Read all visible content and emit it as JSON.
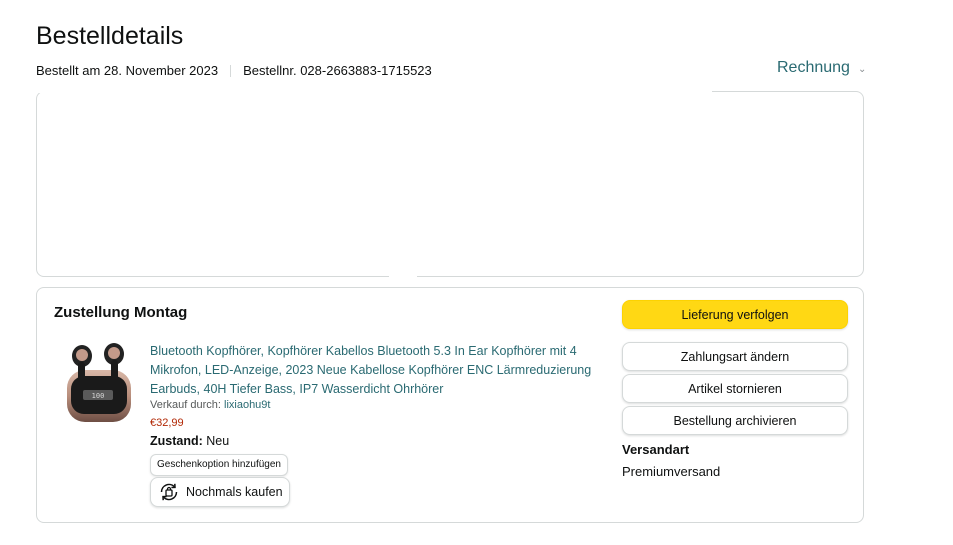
{
  "header": {
    "title": "Bestelldetails",
    "order_date": "Bestellt am 28. November 2023",
    "order_number": "Bestellnr. 028-2663883-1715523",
    "invoice_label": "Rechnung"
  },
  "shipment": {
    "title": "Zustellung Montag",
    "product": {
      "description": "Bluetooth Kopfhörer, Kopfhörer Kabellos Bluetooth 5.3 In Ear Kopfhörer mit 4 Mikrofon, LED-Anzeige, 2023 Neue Kabellose Kopfhörer ENC Lärmreduzierung Earbuds, 40H Tiefer Bass, IP7 Wasserdicht Ohrhörer",
      "sold_by_label": "Verkauf durch:",
      "seller": "lixiaohu9t",
      "price": "€32,99",
      "condition_label": "Zustand:",
      "condition_value": "Neu",
      "gift_option": "Geschenkoption hinzufügen",
      "buy_again": "Nochmals kaufen"
    },
    "actions": {
      "track": "Lieferung verfolgen",
      "change_payment": "Zahlungsart ändern",
      "cancel": "Artikel stornieren",
      "archive": "Bestellung archivieren"
    },
    "shipping_type_label": "Versandart",
    "shipping_type_value": "Premiumversand"
  },
  "colors": {
    "primary_button": "#ffd814",
    "link": "#2a6a72",
    "price": "#b12704",
    "border": "#d5d9d9"
  },
  "icons": {
    "invoice_dropdown": "chevron-down-icon",
    "buy_again": "reorder-icon"
  }
}
